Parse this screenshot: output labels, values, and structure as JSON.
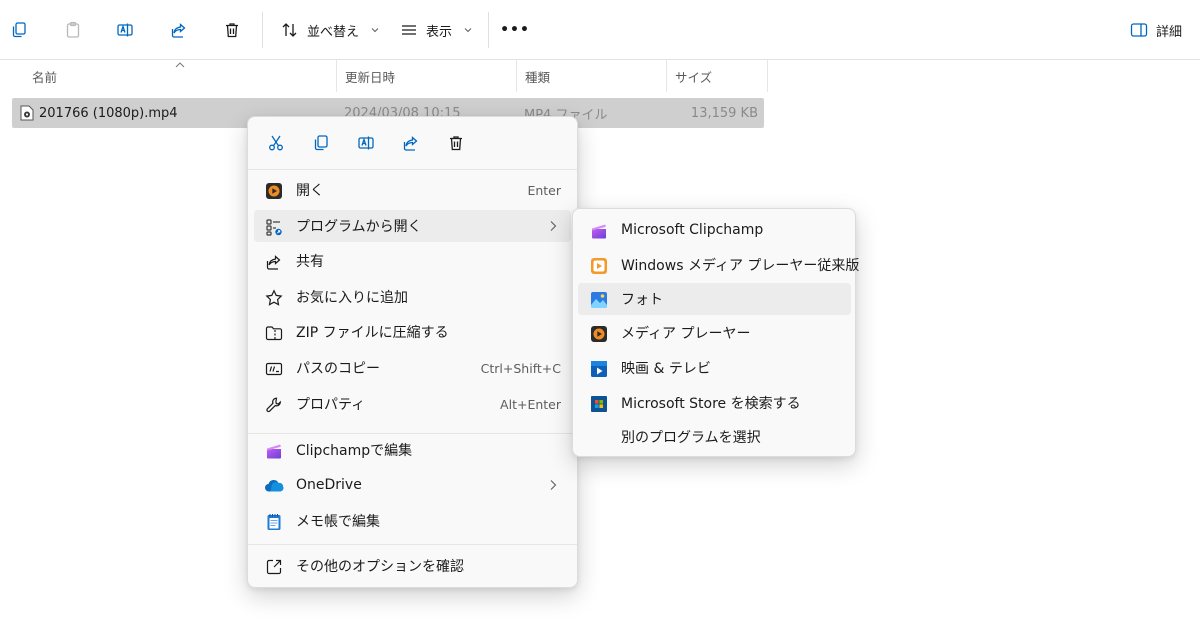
{
  "toolbar": {
    "sort_label": "並べ替え",
    "view_label": "表示",
    "more_label": "•••",
    "details_label": "詳細"
  },
  "columns": {
    "name": "名前",
    "modified": "更新日時",
    "type": "種類",
    "size": "サイズ"
  },
  "file": {
    "name": "201766 (1080p).mp4",
    "modified": "2024/03/08 10:15",
    "type": "MP4 ファイル",
    "size": "13,159 KB"
  },
  "context_menu": {
    "items": [
      {
        "label": "開く",
        "shortcut": "Enter"
      },
      {
        "label": "プログラムから開く",
        "shortcut": ""
      },
      {
        "label": "共有",
        "shortcut": ""
      },
      {
        "label": "お気に入りに追加",
        "shortcut": ""
      },
      {
        "label": "ZIP ファイルに圧縮する",
        "shortcut": ""
      },
      {
        "label": "パスのコピー",
        "shortcut": "Ctrl+Shift+C"
      },
      {
        "label": "プロパティ",
        "shortcut": "Alt+Enter"
      },
      {
        "label": "Clipchampで編集",
        "shortcut": ""
      },
      {
        "label": "OneDrive",
        "shortcut": ""
      },
      {
        "label": "メモ帳で編集",
        "shortcut": ""
      },
      {
        "label": "その他のオプションを確認",
        "shortcut": ""
      }
    ]
  },
  "submenu": {
    "items": [
      {
        "label": "Microsoft Clipchamp"
      },
      {
        "label": "Windows メディア プレーヤー従来版"
      },
      {
        "label": "フォト"
      },
      {
        "label": "メディア プレーヤー"
      },
      {
        "label": "映画 & テレビ"
      },
      {
        "label": "Microsoft Store を検索する"
      },
      {
        "label": "別のプログラムを選択"
      }
    ]
  },
  "colors": {
    "accent": "#0067c0",
    "selection": "#cfcfcf",
    "menu_bg": "#f9f9f9",
    "hover": "#ececec"
  }
}
